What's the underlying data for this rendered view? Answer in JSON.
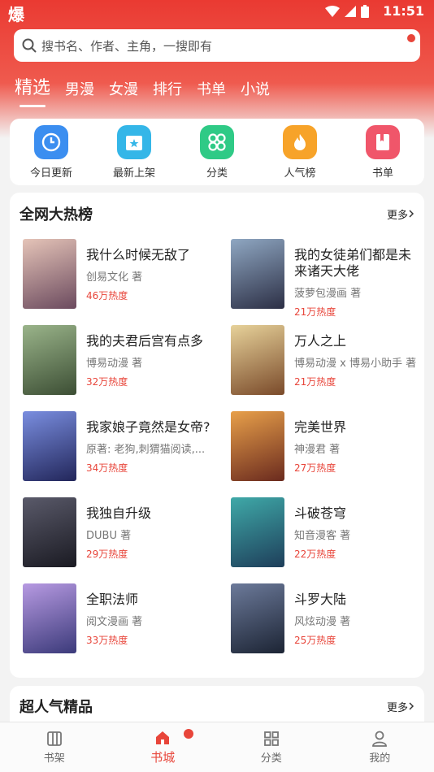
{
  "status": {
    "logo": "爆",
    "time": "11:51"
  },
  "search": {
    "placeholder": "搜书名、作者、主角，一搜即有"
  },
  "tabs": [
    "精选",
    "男漫",
    "女漫",
    "排行",
    "书单",
    "小说"
  ],
  "quick": [
    {
      "label": "今日更新",
      "icon": "clock-icon",
      "color": "#3b8ef0"
    },
    {
      "label": "最新上架",
      "icon": "star-box-icon",
      "color": "#34b6e8"
    },
    {
      "label": "分类",
      "icon": "grid-icon",
      "color": "#2fca86"
    },
    {
      "label": "人气榜",
      "icon": "flame-icon",
      "color": "#f7a329"
    },
    {
      "label": "书单",
      "icon": "book-icon",
      "color": "#f0566a"
    }
  ],
  "section1": {
    "title": "全网大热榜",
    "more": "更多",
    "books": [
      {
        "title": "我什么时候无敌了",
        "author": "创易文化 著",
        "heat": "46万热度",
        "cover": [
          "#e5c4b8",
          "#6b4a5e"
        ]
      },
      {
        "title": "我的女徒弟们都是未来诸天大佬",
        "author": "菠萝包漫画 著",
        "heat": "21万热度",
        "cover": [
          "#8fa7c2",
          "#2c2f45"
        ]
      },
      {
        "title": "我的夫君后宫有点多",
        "author": "博易动漫 著",
        "heat": "32万热度",
        "cover": [
          "#9ab48a",
          "#3c4e34"
        ]
      },
      {
        "title": "万人之上",
        "author": "博易动漫 x 博易小助手 著",
        "heat": "21万热度",
        "cover": [
          "#e7d29a",
          "#7a4a2a"
        ]
      },
      {
        "title": "我家娘子竟然是女帝?",
        "author": "原著: 老狗,刺猬猫阅读,...",
        "heat": "34万热度",
        "cover": [
          "#7a8ee0",
          "#22265a"
        ]
      },
      {
        "title": "完美世界",
        "author": "神漫君 著",
        "heat": "27万热度",
        "cover": [
          "#e8a04a",
          "#6a2a1e"
        ]
      },
      {
        "title": "我独自升级",
        "author": "DUBU 著",
        "heat": "29万热度",
        "cover": [
          "#5a5a6a",
          "#1a1a22"
        ]
      },
      {
        "title": "斗破苍穹",
        "author": "知音漫客 著",
        "heat": "22万热度",
        "cover": [
          "#3fa9a8",
          "#1e3e5a"
        ]
      },
      {
        "title": "全职法师",
        "author": "阅文漫画 著",
        "heat": "33万热度",
        "cover": [
          "#b79ae2",
          "#3b3a7a"
        ]
      },
      {
        "title": "斗罗大陆",
        "author": "风炫动漫 著",
        "heat": "25万热度",
        "cover": [
          "#6c7a9a",
          "#1c2434"
        ]
      }
    ]
  },
  "section2": {
    "title": "超人气精品",
    "more": "更多"
  },
  "bottom_nav": [
    {
      "label": "书架",
      "icon": "shelf-icon"
    },
    {
      "label": "书城",
      "icon": "home-icon"
    },
    {
      "label": "分类",
      "icon": "category-icon"
    },
    {
      "label": "我的",
      "icon": "user-icon"
    }
  ]
}
